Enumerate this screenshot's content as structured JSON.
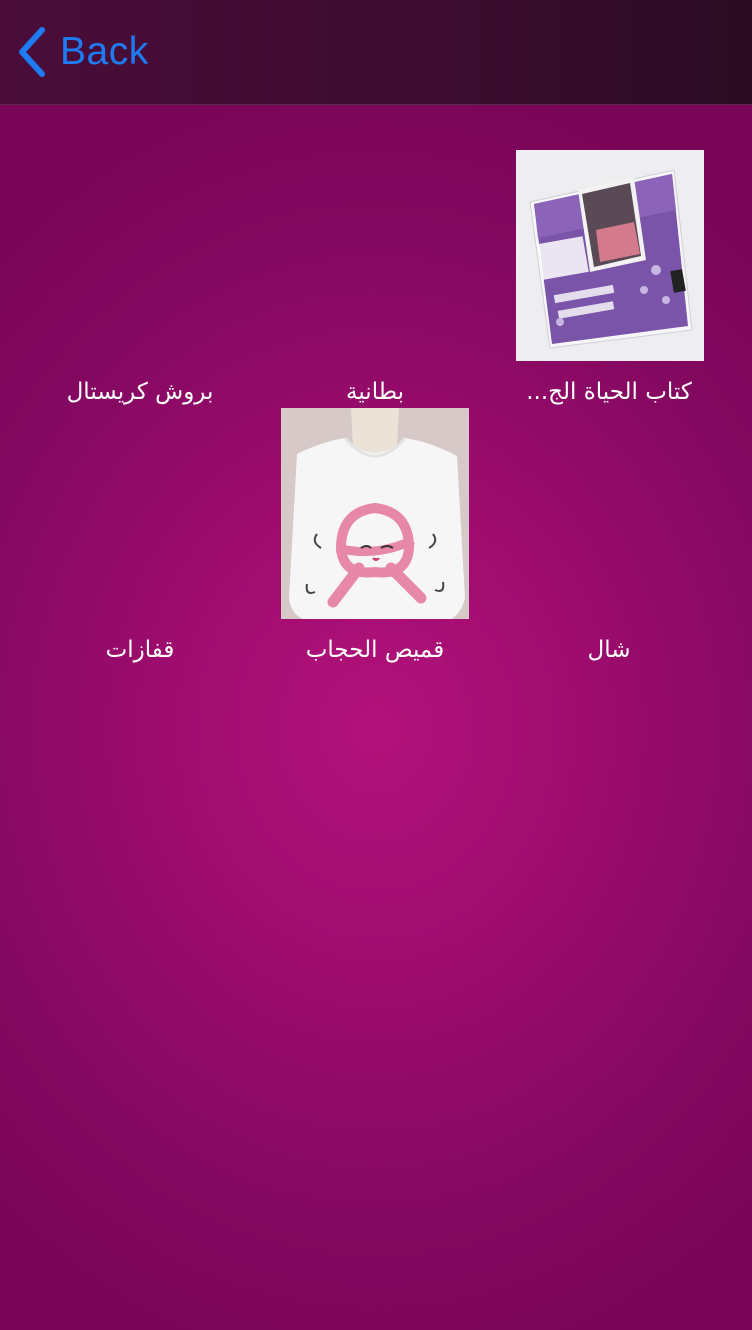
{
  "navbar": {
    "back_label": "Back",
    "back_icon": "chevron-left-icon",
    "accent_color": "#1e7bf2"
  },
  "background": {
    "center_color": "#b2127a",
    "edge_color": "#780556"
  },
  "items": [
    {
      "label": "كتاب الحياة الج...",
      "has_image": true,
      "image": "book-cover"
    },
    {
      "label": "بطانية",
      "has_image": false
    },
    {
      "label": "بروش كريستال",
      "has_image": false
    },
    {
      "label": "شال",
      "has_image": false
    },
    {
      "label": "قميص الحجاب",
      "has_image": true,
      "image": "hijab-ribbon-tshirt"
    },
    {
      "label": "قفازات",
      "has_image": false
    }
  ]
}
